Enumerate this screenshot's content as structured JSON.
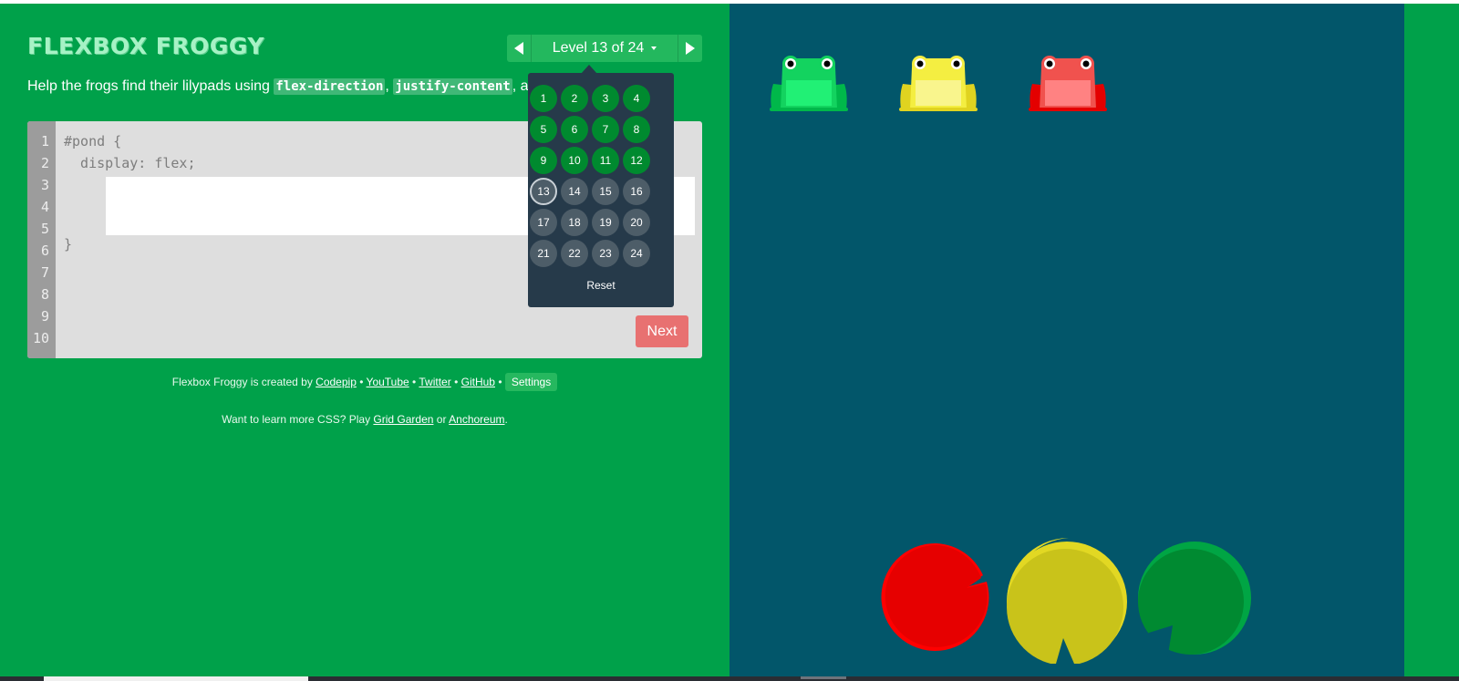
{
  "header": {
    "title": "FLEXBOX FROGGY",
    "level_label": "Level 13 of 24"
  },
  "instructions": {
    "prefix": "Help the frogs find their lilypads using ",
    "code1": "flex-direction",
    "sep1": ", ",
    "code2": "justify-content",
    "suffix": ", anc"
  },
  "editor": {
    "line_numbers": [
      "1",
      "2",
      "3",
      "4",
      "5",
      "6",
      "7",
      "8",
      "9",
      "10"
    ],
    "line1": "#pond {",
    "line2": "  display: flex;",
    "closing": "}",
    "input_value": "",
    "next_label": "Next"
  },
  "level_menu": {
    "levels": [
      "1",
      "2",
      "3",
      "4",
      "5",
      "6",
      "7",
      "8",
      "9",
      "10",
      "11",
      "12",
      "13",
      "14",
      "15",
      "16",
      "17",
      "18",
      "19",
      "20",
      "21",
      "22",
      "23",
      "24"
    ],
    "solved_count": 12,
    "current_level": 13,
    "reset_label": "Reset"
  },
  "credits": {
    "text": "Flexbox Froggy is created by ",
    "links": [
      "Codepip",
      "YouTube",
      "Twitter",
      "GitHub"
    ],
    "separator": "•",
    "settings_label": "Settings"
  },
  "more_css": {
    "prefix": "Want to learn more CSS? Play ",
    "link1": "Grid Garden",
    "middle": " or ",
    "link2": "Anchoreum",
    "suffix": "."
  },
  "pond": {
    "frogs": [
      "green",
      "yellow",
      "red"
    ],
    "lilypads": [
      "red",
      "yellow",
      "green"
    ]
  },
  "colors": {
    "page_green": "#00a14a",
    "pond_blue": "#02566a",
    "dropdown_bg": "#263a4a",
    "solved_level": "#008a2f",
    "unsolved_level": "#4d5d68",
    "next_button": "#e87171",
    "title_text": "#a6f2c5",
    "frog_green": "#13d35f",
    "frog_yellow": "#f4ee41",
    "frog_red": "#f0524e",
    "pad_red": "#e60000",
    "pad_yellow": "#c9c31a",
    "pad_green": "#008a31"
  }
}
